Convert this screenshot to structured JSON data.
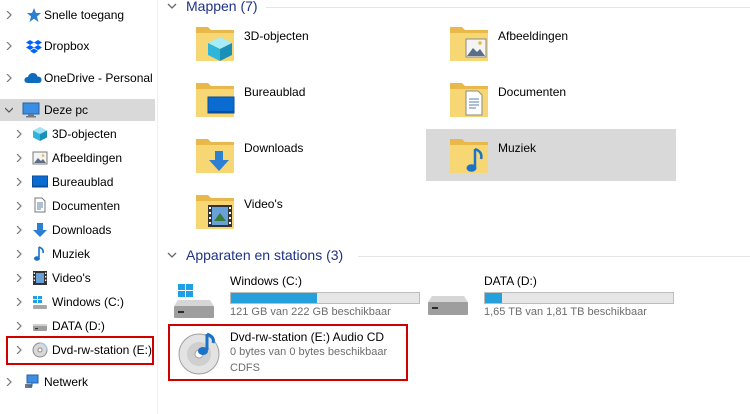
{
  "nav": {
    "items": [
      {
        "label": "Snelle toegang",
        "icon": "star-icon",
        "expander": "collapsed"
      },
      {
        "label": "Dropbox",
        "icon": "dropbox-icon",
        "expander": "collapsed"
      },
      {
        "label": "OneDrive - Personal",
        "icon": "onedrive-icon",
        "expander": "collapsed"
      },
      {
        "label": "Deze pc",
        "icon": "pc-icon",
        "expander": "expanded",
        "selected": true
      },
      {
        "label": "3D-objecten",
        "icon": "cube-icon",
        "expander": "collapsed"
      },
      {
        "label": "Afbeeldingen",
        "icon": "pictures-icon",
        "expander": "collapsed"
      },
      {
        "label": "Bureaublad",
        "icon": "desktop-icon",
        "expander": "collapsed"
      },
      {
        "label": "Documenten",
        "icon": "documents-icon",
        "expander": "collapsed"
      },
      {
        "label": "Downloads",
        "icon": "download-icon",
        "expander": "collapsed"
      },
      {
        "label": "Muziek",
        "icon": "music-icon",
        "expander": "collapsed"
      },
      {
        "label": "Video's",
        "icon": "video-icon",
        "expander": "collapsed"
      },
      {
        "label": "Windows (C:)",
        "icon": "windows-drive-icon",
        "expander": "collapsed"
      },
      {
        "label": "DATA (D:)",
        "icon": "drive-icon",
        "expander": "collapsed"
      },
      {
        "label": "Dvd-rw-station (E:)",
        "icon": "cd-icon",
        "expander": "collapsed",
        "highlighted": true
      },
      {
        "label": "Netwerk",
        "icon": "network-icon",
        "expander": "collapsed"
      }
    ]
  },
  "groups": {
    "folders_title": "Mappen (7)",
    "drives_title": "Apparaten en stations (3)"
  },
  "folders": [
    {
      "label": "3D-objecten",
      "icon": "cube-folder-icon"
    },
    {
      "label": "Afbeeldingen",
      "icon": "pictures-folder-icon"
    },
    {
      "label": "Bureaublad",
      "icon": "desktop-folder-icon"
    },
    {
      "label": "Documenten",
      "icon": "documents-folder-icon"
    },
    {
      "label": "Downloads",
      "icon": "downloads-folder-icon"
    },
    {
      "label": "Muziek",
      "icon": "music-folder-icon",
      "selected": true
    },
    {
      "label": "Video's",
      "icon": "video-folder-icon"
    }
  ],
  "drives": [
    {
      "name": "Windows (C:)",
      "info": "121 GB van 222 GB beschikbaar",
      "used_fraction": 0.455,
      "icon": "windows-drive-icon"
    },
    {
      "name": "DATA (D:)",
      "info": "1,65 TB van 1,81 TB beschikbaar",
      "used_fraction": 0.088,
      "icon": "drive-icon"
    },
    {
      "name": "Dvd-rw-station (E:) Audio CD",
      "info": "0 bytes van 0 bytes beschikbaar",
      "info2": "CDFS",
      "icon": "audio-cd-icon",
      "highlighted": true
    }
  ],
  "colors": {
    "accent": "#26a0da",
    "selection": "#d9d9d9",
    "highlight_border": "#d00000",
    "group_title": "#1e3287"
  }
}
